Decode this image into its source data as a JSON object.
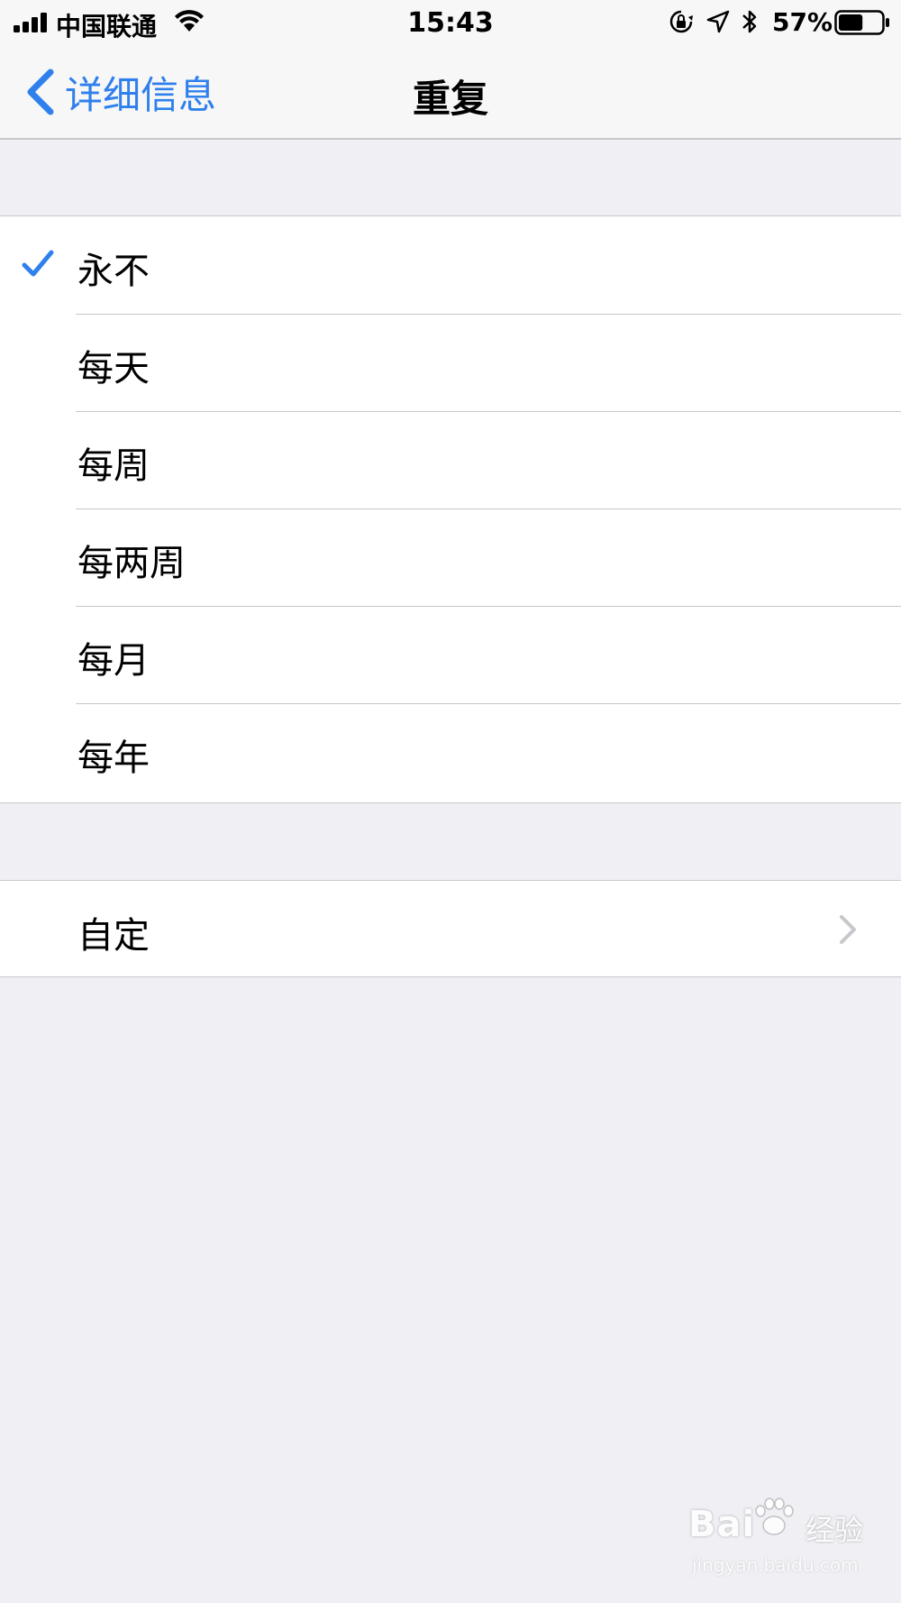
{
  "status_bar": {
    "carrier": "中国联通",
    "time": "15:43",
    "battery_percent": "57%",
    "battery_level": 0.57,
    "signal_bars": 4,
    "icons": [
      "signal-icon",
      "wifi-icon",
      "orientation-lock-icon",
      "location-arrow-icon",
      "bluetooth-icon",
      "battery-icon"
    ]
  },
  "nav": {
    "back_label": "详细信息",
    "title": "重复"
  },
  "repeat_options": [
    {
      "label": "永不",
      "selected": true
    },
    {
      "label": "每天",
      "selected": false
    },
    {
      "label": "每周",
      "selected": false
    },
    {
      "label": "每两周",
      "selected": false
    },
    {
      "label": "每月",
      "selected": false
    },
    {
      "label": "每年",
      "selected": false
    }
  ],
  "custom": {
    "label": "自定"
  },
  "watermark": {
    "logo_text": "Bai",
    "logo_text_2": "经验",
    "url": "jingyan.baidu.com"
  },
  "colors": {
    "accent": "#2f80ed",
    "background": "#efeff4",
    "separator": "#c8c7cc",
    "bar_background": "#f7f7f7",
    "chevron": "#c7c7cc"
  }
}
